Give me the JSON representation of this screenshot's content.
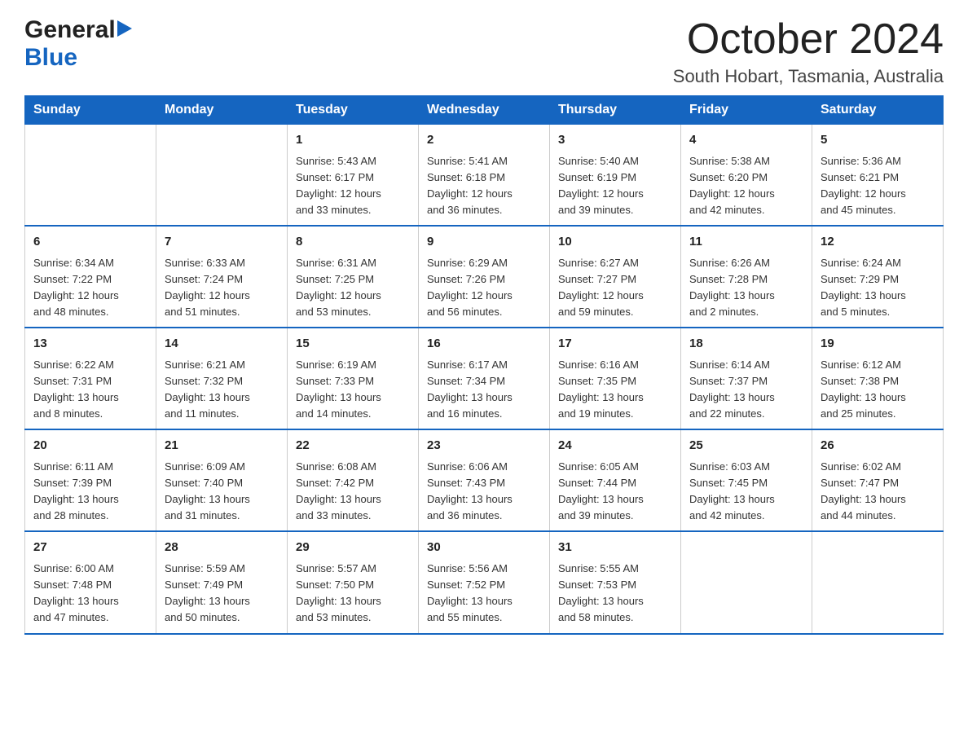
{
  "header": {
    "logo_general": "General",
    "logo_blue": "Blue",
    "main_title": "October 2024",
    "subtitle": "South Hobart, Tasmania, Australia"
  },
  "calendar": {
    "days_of_week": [
      "Sunday",
      "Monday",
      "Tuesday",
      "Wednesday",
      "Thursday",
      "Friday",
      "Saturday"
    ],
    "weeks": [
      [
        {
          "day": "",
          "info": ""
        },
        {
          "day": "",
          "info": ""
        },
        {
          "day": "1",
          "info": "Sunrise: 5:43 AM\nSunset: 6:17 PM\nDaylight: 12 hours\nand 33 minutes."
        },
        {
          "day": "2",
          "info": "Sunrise: 5:41 AM\nSunset: 6:18 PM\nDaylight: 12 hours\nand 36 minutes."
        },
        {
          "day": "3",
          "info": "Sunrise: 5:40 AM\nSunset: 6:19 PM\nDaylight: 12 hours\nand 39 minutes."
        },
        {
          "day": "4",
          "info": "Sunrise: 5:38 AM\nSunset: 6:20 PM\nDaylight: 12 hours\nand 42 minutes."
        },
        {
          "day": "5",
          "info": "Sunrise: 5:36 AM\nSunset: 6:21 PM\nDaylight: 12 hours\nand 45 minutes."
        }
      ],
      [
        {
          "day": "6",
          "info": "Sunrise: 6:34 AM\nSunset: 7:22 PM\nDaylight: 12 hours\nand 48 minutes."
        },
        {
          "day": "7",
          "info": "Sunrise: 6:33 AM\nSunset: 7:24 PM\nDaylight: 12 hours\nand 51 minutes."
        },
        {
          "day": "8",
          "info": "Sunrise: 6:31 AM\nSunset: 7:25 PM\nDaylight: 12 hours\nand 53 minutes."
        },
        {
          "day": "9",
          "info": "Sunrise: 6:29 AM\nSunset: 7:26 PM\nDaylight: 12 hours\nand 56 minutes."
        },
        {
          "day": "10",
          "info": "Sunrise: 6:27 AM\nSunset: 7:27 PM\nDaylight: 12 hours\nand 59 minutes."
        },
        {
          "day": "11",
          "info": "Sunrise: 6:26 AM\nSunset: 7:28 PM\nDaylight: 13 hours\nand 2 minutes."
        },
        {
          "day": "12",
          "info": "Sunrise: 6:24 AM\nSunset: 7:29 PM\nDaylight: 13 hours\nand 5 minutes."
        }
      ],
      [
        {
          "day": "13",
          "info": "Sunrise: 6:22 AM\nSunset: 7:31 PM\nDaylight: 13 hours\nand 8 minutes."
        },
        {
          "day": "14",
          "info": "Sunrise: 6:21 AM\nSunset: 7:32 PM\nDaylight: 13 hours\nand 11 minutes."
        },
        {
          "day": "15",
          "info": "Sunrise: 6:19 AM\nSunset: 7:33 PM\nDaylight: 13 hours\nand 14 minutes."
        },
        {
          "day": "16",
          "info": "Sunrise: 6:17 AM\nSunset: 7:34 PM\nDaylight: 13 hours\nand 16 minutes."
        },
        {
          "day": "17",
          "info": "Sunrise: 6:16 AM\nSunset: 7:35 PM\nDaylight: 13 hours\nand 19 minutes."
        },
        {
          "day": "18",
          "info": "Sunrise: 6:14 AM\nSunset: 7:37 PM\nDaylight: 13 hours\nand 22 minutes."
        },
        {
          "day": "19",
          "info": "Sunrise: 6:12 AM\nSunset: 7:38 PM\nDaylight: 13 hours\nand 25 minutes."
        }
      ],
      [
        {
          "day": "20",
          "info": "Sunrise: 6:11 AM\nSunset: 7:39 PM\nDaylight: 13 hours\nand 28 minutes."
        },
        {
          "day": "21",
          "info": "Sunrise: 6:09 AM\nSunset: 7:40 PM\nDaylight: 13 hours\nand 31 minutes."
        },
        {
          "day": "22",
          "info": "Sunrise: 6:08 AM\nSunset: 7:42 PM\nDaylight: 13 hours\nand 33 minutes."
        },
        {
          "day": "23",
          "info": "Sunrise: 6:06 AM\nSunset: 7:43 PM\nDaylight: 13 hours\nand 36 minutes."
        },
        {
          "day": "24",
          "info": "Sunrise: 6:05 AM\nSunset: 7:44 PM\nDaylight: 13 hours\nand 39 minutes."
        },
        {
          "day": "25",
          "info": "Sunrise: 6:03 AM\nSunset: 7:45 PM\nDaylight: 13 hours\nand 42 minutes."
        },
        {
          "day": "26",
          "info": "Sunrise: 6:02 AM\nSunset: 7:47 PM\nDaylight: 13 hours\nand 44 minutes."
        }
      ],
      [
        {
          "day": "27",
          "info": "Sunrise: 6:00 AM\nSunset: 7:48 PM\nDaylight: 13 hours\nand 47 minutes."
        },
        {
          "day": "28",
          "info": "Sunrise: 5:59 AM\nSunset: 7:49 PM\nDaylight: 13 hours\nand 50 minutes."
        },
        {
          "day": "29",
          "info": "Sunrise: 5:57 AM\nSunset: 7:50 PM\nDaylight: 13 hours\nand 53 minutes."
        },
        {
          "day": "30",
          "info": "Sunrise: 5:56 AM\nSunset: 7:52 PM\nDaylight: 13 hours\nand 55 minutes."
        },
        {
          "day": "31",
          "info": "Sunrise: 5:55 AM\nSunset: 7:53 PM\nDaylight: 13 hours\nand 58 minutes."
        },
        {
          "day": "",
          "info": ""
        },
        {
          "day": "",
          "info": ""
        }
      ]
    ]
  }
}
